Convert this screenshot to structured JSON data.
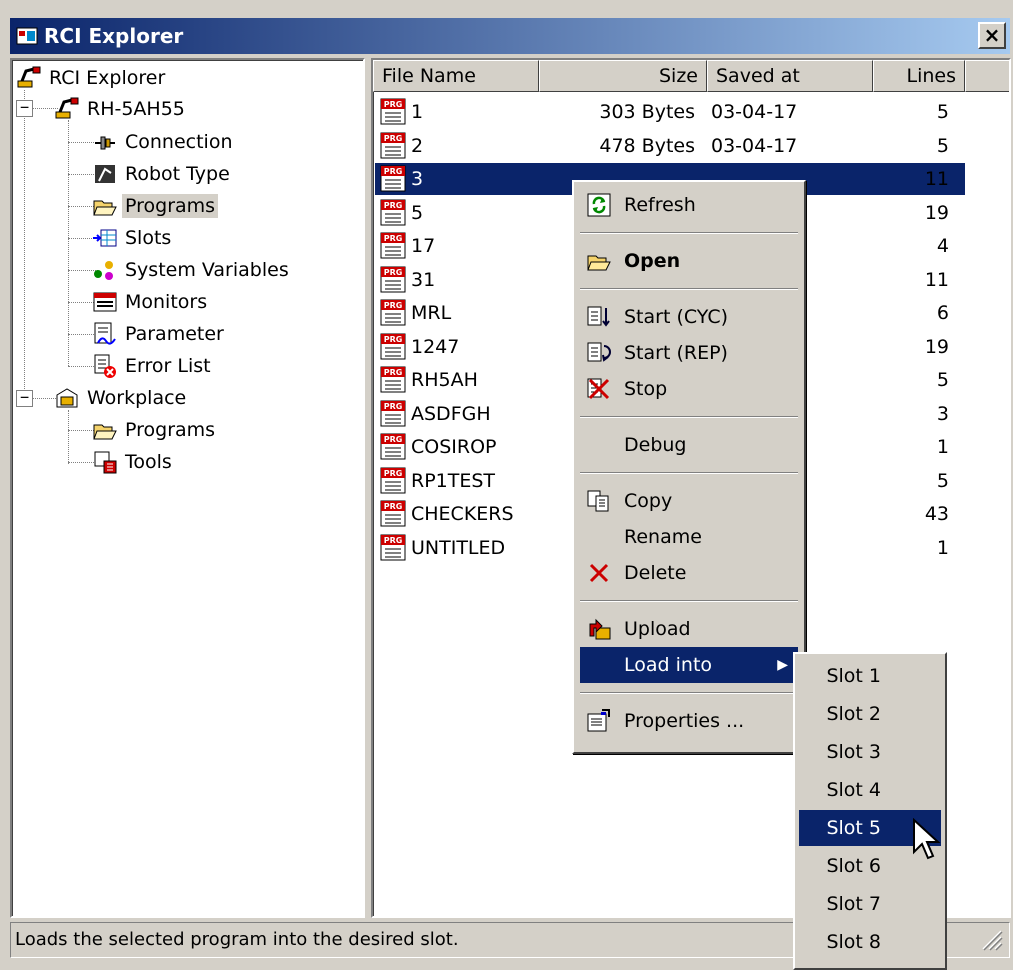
{
  "window": {
    "title": "RCI Explorer",
    "close_label": "×"
  },
  "tree": {
    "root": "RCI Explorer",
    "robot": {
      "label": "RH-5AH55",
      "expander": "−"
    },
    "robot_children": [
      {
        "label": "Connection",
        "icon": "connection-icon"
      },
      {
        "label": "Robot Type",
        "icon": "robot-type-icon"
      },
      {
        "label": "Programs",
        "icon": "folder-open-icon",
        "selected": true
      },
      {
        "label": "Slots",
        "icon": "slots-icon"
      },
      {
        "label": "System Variables",
        "icon": "system-variables-icon"
      },
      {
        "label": "Monitors",
        "icon": "monitors-icon"
      },
      {
        "label": "Parameter",
        "icon": "parameter-icon"
      },
      {
        "label": "Error List",
        "icon": "error-list-icon"
      }
    ],
    "workplace": {
      "label": "Workplace",
      "expander": "−"
    },
    "workplace_children": [
      {
        "label": "Programs",
        "icon": "folder-open-icon"
      },
      {
        "label": "Tools",
        "icon": "tools-icon"
      }
    ]
  },
  "list": {
    "columns": [
      "File Name",
      "Size",
      "Saved at",
      "Lines"
    ],
    "rows": [
      {
        "name": "1",
        "size": "303 Bytes",
        "saved": "03-04-17",
        "lines": "5"
      },
      {
        "name": "2",
        "size": "478 Bytes",
        "saved": "03-04-17",
        "lines": "5"
      },
      {
        "name": "3",
        "size": "",
        "saved": "",
        "lines": "11",
        "selected": true
      },
      {
        "name": "5",
        "size": "",
        "saved": "",
        "lines": "19"
      },
      {
        "name": "17",
        "size": "",
        "saved": "",
        "lines": "4"
      },
      {
        "name": "31",
        "size": "",
        "saved": "",
        "lines": "11"
      },
      {
        "name": "MRL",
        "size": "",
        "saved": "",
        "lines": "6"
      },
      {
        "name": "1247",
        "size": "",
        "saved": "",
        "lines": "19"
      },
      {
        "name": "RH5AH",
        "size": "",
        "saved": "",
        "lines": "5"
      },
      {
        "name": "ASDFGH",
        "size": "",
        "saved": "",
        "lines": "3"
      },
      {
        "name": "COSIROP",
        "size": "",
        "saved": "",
        "lines": "1"
      },
      {
        "name": "RP1TEST",
        "size": "",
        "saved": "",
        "lines": "5"
      },
      {
        "name": "CHECKERS",
        "size": "",
        "saved": "",
        "lines": "43"
      },
      {
        "name": "UNTITLED",
        "size": "",
        "saved": "",
        "lines": "1"
      }
    ],
    "file_icon_text": "PRG"
  },
  "context_menu": {
    "refresh": "Refresh",
    "open": "Open",
    "start_cyc": "Start (CYC)",
    "start_rep": "Start (REP)",
    "stop": "Stop",
    "debug": "Debug",
    "copy": "Copy",
    "rename": "Rename",
    "delete": "Delete",
    "upload": "Upload",
    "load_into": "Load into",
    "load_into_arrow": "▶",
    "properties": "Properties ..."
  },
  "submenu": {
    "slots": [
      "Slot 1",
      "Slot 2",
      "Slot 3",
      "Slot 4",
      "Slot 5",
      "Slot 6",
      "Slot 7",
      "Slot 8"
    ],
    "highlighted": "Slot 5"
  },
  "status": {
    "text": "Loads the selected program into the desired slot."
  },
  "colors": {
    "selection": "#0a246a",
    "face": "#d4d0c8",
    "title_start": "#0a246a",
    "title_end": "#a6caf0"
  }
}
